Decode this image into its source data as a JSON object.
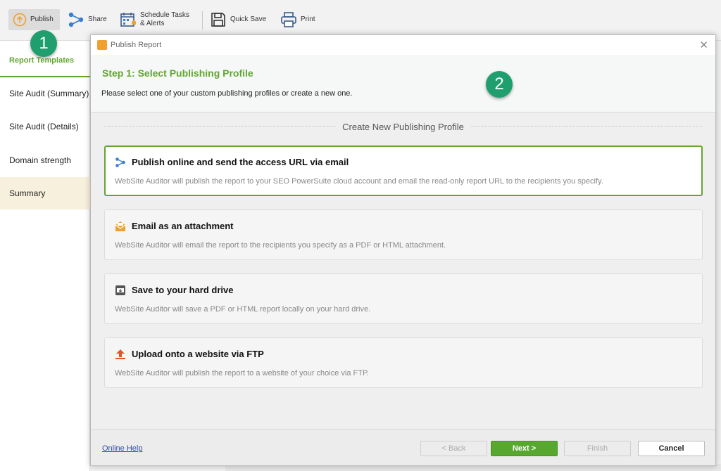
{
  "toolbar": {
    "publish": "Publish",
    "share": "Share",
    "schedule_line1": "Schedule Tasks",
    "schedule_line2": "& Alerts",
    "quick_save": "Quick Save",
    "print": "Print"
  },
  "sidebar": {
    "header": "Report Templates",
    "items": [
      {
        "label": "Site Audit (Summary)"
      },
      {
        "label": "Site Audit (Details)"
      },
      {
        "label": "Domain strength"
      },
      {
        "label": "Summary"
      }
    ]
  },
  "badges": {
    "one": "1",
    "two": "2"
  },
  "dialog": {
    "title": "Publish Report",
    "close": "✕",
    "step_title": "Step 1: Select Publishing Profile",
    "step_desc": "Please select one of your custom publishing profiles or create a new one.",
    "section_title": "Create New Publishing Profile",
    "options": [
      {
        "title": "Publish online and send the access URL via email",
        "desc": "WebSite Auditor will publish the report to your SEO PowerSuite cloud account and email the read-only report URL to the recipients you specify.",
        "icon": "share-icon"
      },
      {
        "title": "Email as an attachment",
        "desc": "WebSite Auditor will email the report to the recipients you specify as a PDF or HTML attachment.",
        "icon": "envelope-icon"
      },
      {
        "title": "Save to your hard drive",
        "desc": "WebSite Auditor will save a PDF or HTML report locally on your hard drive.",
        "icon": "hard-drive-icon"
      },
      {
        "title": "Upload onto a website via FTP",
        "desc": "WebSite Auditor will publish the report to a website of your choice via FTP.",
        "icon": "upload-icon"
      }
    ],
    "footer": {
      "help": "Online Help",
      "back": "< Back",
      "next": "Next >",
      "finish": "Finish",
      "cancel": "Cancel"
    }
  },
  "colors": {
    "accent": "#62a630",
    "badge": "#1f9e6e",
    "orange": "#f0a030",
    "ftp": "#e0562a"
  }
}
